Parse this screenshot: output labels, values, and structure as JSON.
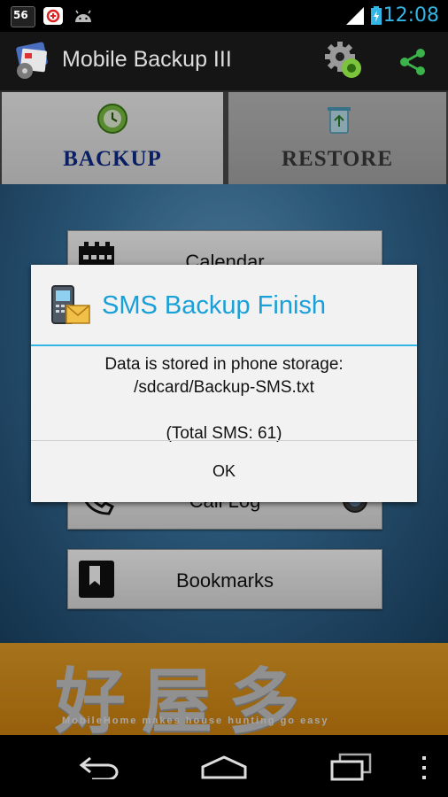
{
  "status_bar": {
    "time": "12:08",
    "notification_text": "56"
  },
  "app_bar": {
    "title": "Mobile Backup III"
  },
  "tabs": [
    {
      "label": "BACKUP"
    },
    {
      "label": "RESTORE"
    }
  ],
  "items": [
    {
      "label": "Calendar"
    },
    {
      "label": "Call Log"
    },
    {
      "label": "Bookmarks"
    }
  ],
  "ad": {
    "headline": "好屋多",
    "tagline": "MobileHome makes house hunting go easy"
  },
  "dialog": {
    "title": "SMS Backup Finish",
    "message_line1": "Data is stored in phone storage:",
    "message_line2": "/sdcard/Backup-SMS.txt",
    "message_line3": "(Total SMS: 61)",
    "ok_label": "OK"
  },
  "colors": {
    "accent": "#33b5e5",
    "backup_tab_text": "#0e2c8a",
    "ad_bg": "#d88f1a"
  }
}
